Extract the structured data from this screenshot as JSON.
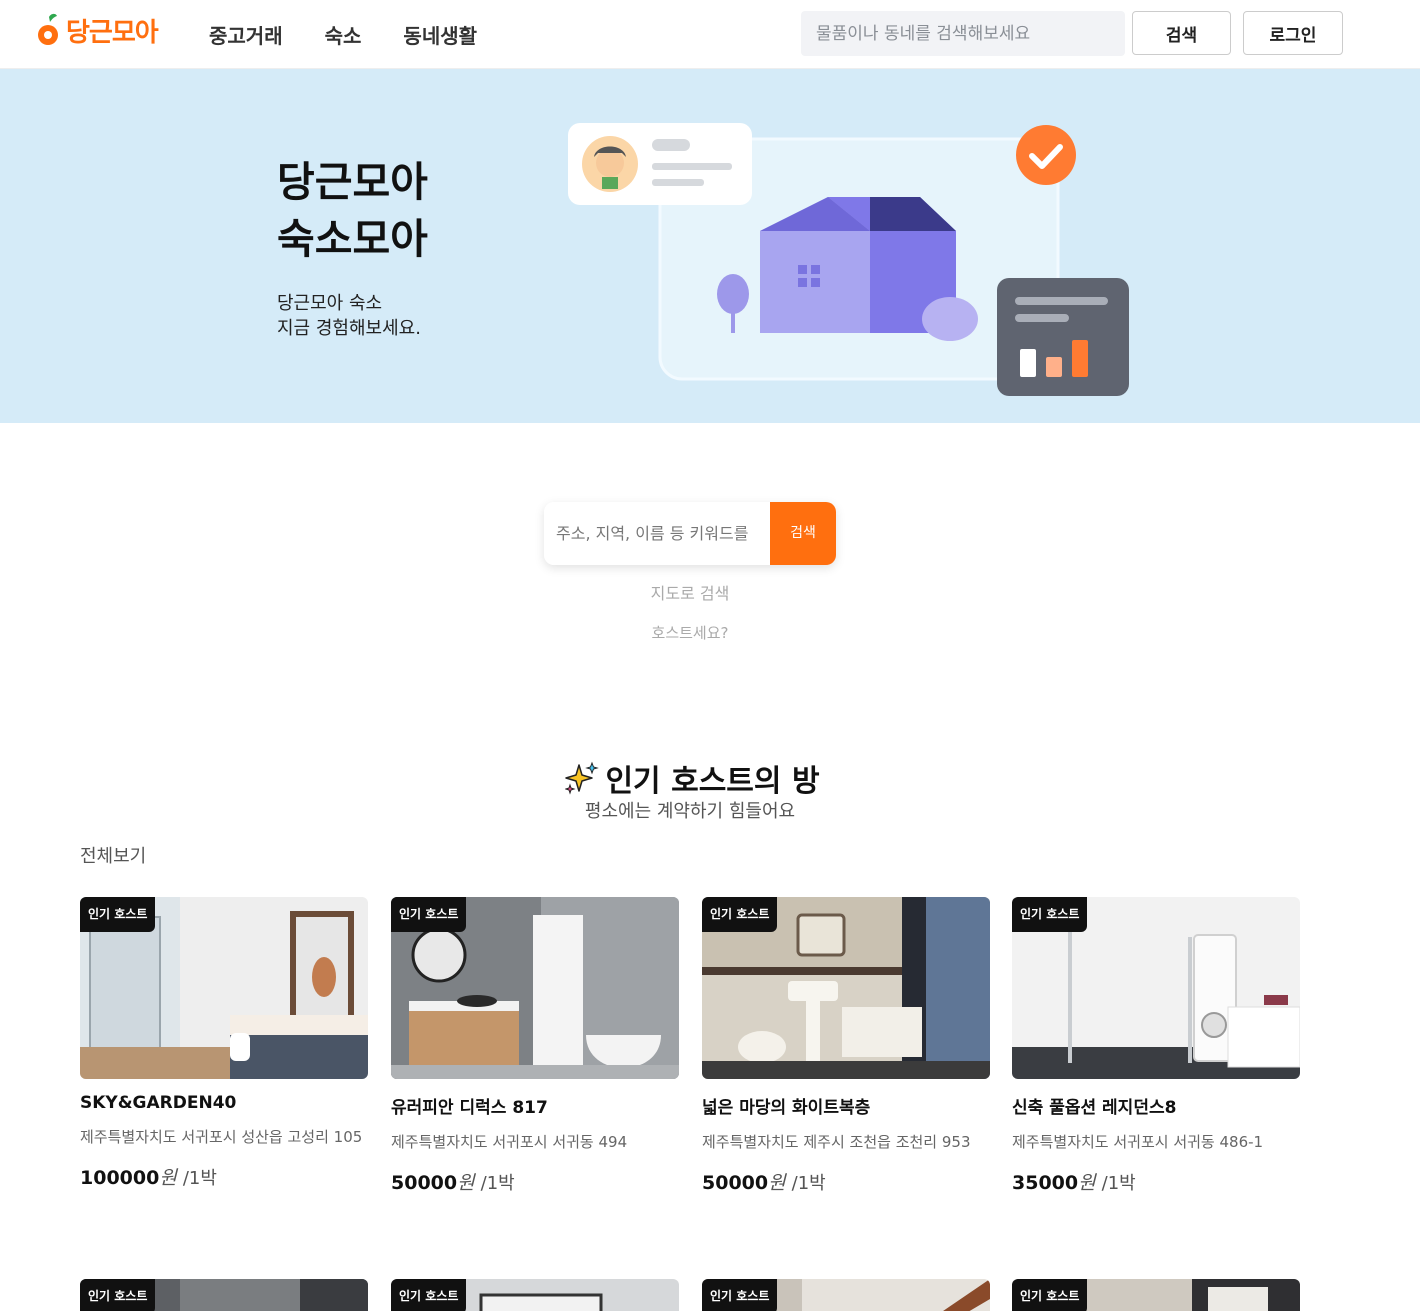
{
  "header": {
    "logo_text": "당근모아",
    "nav": [
      "중고거래",
      "숙소",
      "동네생활"
    ],
    "search_placeholder": "물품이나 동네를 검색해보세요",
    "search_button": "검색",
    "login_button": "로그인"
  },
  "hero": {
    "title_line1": "당근모아",
    "title_line2": "숙소모아",
    "sub_line1": "당근모아 숙소",
    "sub_line2": "지금 경험해보세요."
  },
  "center_search": {
    "placeholder": "주소, 지역, 이름 등 키워드를",
    "button": "검색",
    "map_link": "지도로 검색",
    "host_link": "호스트세요?"
  },
  "section": {
    "title": "인기 호스트의 방",
    "subtitle": "평소에는 계약하기 힘들어요",
    "view_all": "전체보기"
  },
  "listings": [
    {
      "badge": "인기 호스트",
      "name": "SKY&GARDEN40",
      "address": "제주특별자치도 서귀포시 성산읍 고성리 105",
      "price": "100000",
      "currency": "원",
      "unit": "/1박"
    },
    {
      "badge": "인기 호스트",
      "name": "유러피안 디럭스 817",
      "address": "제주특별자치도 서귀포시 서귀동 494",
      "price": "50000",
      "currency": "원",
      "unit": "/1박"
    },
    {
      "badge": "인기 호스트",
      "name": "넓은 마당의 화이트복층",
      "address": "제주특별자치도 제주시 조천읍 조천리 953",
      "price": "50000",
      "currency": "원",
      "unit": "/1박"
    },
    {
      "badge": "인기 호스트",
      "name": "신축 풀옵션 레지던스8",
      "address": "제주특별자치도 서귀포시 서귀동 486-1",
      "price": "35000",
      "currency": "원",
      "unit": "/1박"
    }
  ],
  "listings_row2": [
    {
      "badge": "인기 호스트"
    },
    {
      "badge": "인기 호스트"
    },
    {
      "badge": "인기 호스트"
    },
    {
      "badge": "인기 호스트"
    }
  ],
  "colors": {
    "brand": "#ff6f0f",
    "hero_bg": "#d5ebf8"
  }
}
